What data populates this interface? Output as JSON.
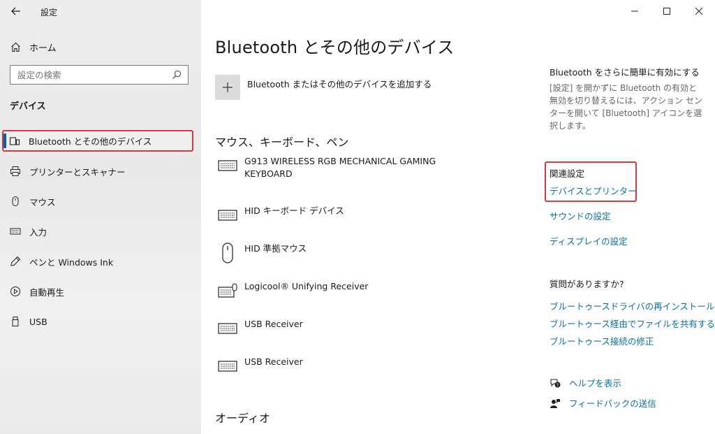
{
  "window": {
    "app_title": "設定",
    "controls": [
      "minimize",
      "maximize",
      "close"
    ]
  },
  "sidebar": {
    "home_label": "ホーム",
    "search_placeholder": "設定の検索",
    "section_label": "デバイス",
    "items": [
      {
        "label": "Bluetooth とその他のデバイス",
        "icon": "bluetooth-devices-icon",
        "selected": true
      },
      {
        "label": "プリンターとスキャナー",
        "icon": "printer-icon"
      },
      {
        "label": "マウス",
        "icon": "mouse-icon"
      },
      {
        "label": "入力",
        "icon": "keyboard-icon"
      },
      {
        "label": "ペンと Windows Ink",
        "icon": "pen-icon"
      },
      {
        "label": "自動再生",
        "icon": "autoplay-icon"
      },
      {
        "label": "USB",
        "icon": "usb-icon"
      }
    ]
  },
  "main": {
    "title": "Bluetooth とその他のデバイス",
    "add_device_label": "Bluetooth またはその他のデバイスを追加する",
    "group_input": "マウス、キーボード、ペン",
    "devices": [
      {
        "name": "G913 WIRELESS RGB MECHANICAL GAMING KEYBOARD",
        "icon": "keyboard-icon"
      },
      {
        "name": "HID キーボード デバイス",
        "icon": "keyboard-icon"
      },
      {
        "name": "HID 準拠マウス",
        "icon": "mouse-icon"
      },
      {
        "name": "Logicool® Unifying Receiver",
        "icon": "keyboard-mouse-icon"
      },
      {
        "name": "USB Receiver",
        "icon": "keyboard-icon"
      },
      {
        "name": "USB Receiver",
        "icon": "keyboard-icon"
      }
    ],
    "group_audio": "オーディオ"
  },
  "right": {
    "bt_heading": "Bluetooth をさらに簡単に有効にする",
    "bt_desc": "[設定] を開かずに Bluetooth の有効と無効を切り替えるには、アクション センターを開いて [Bluetooth] アイコンを選択します。",
    "related_heading": "関連設定",
    "related_links": [
      "デバイスとプリンター",
      "サウンドの設定",
      "ディスプレイの設定"
    ],
    "question_heading": "質問がありますか?",
    "question_links": [
      "ブルートゥースドライバの再インストール",
      "ブルートゥース経由でファイルを共有する",
      "ブルートゥース接続の修正"
    ],
    "help_label": "ヘルプを表示",
    "feedback_label": "フィードバックの送信"
  },
  "colors": {
    "accent": "#0063b1",
    "link": "#0a6fa6",
    "highlight_box": "#d9363e"
  }
}
